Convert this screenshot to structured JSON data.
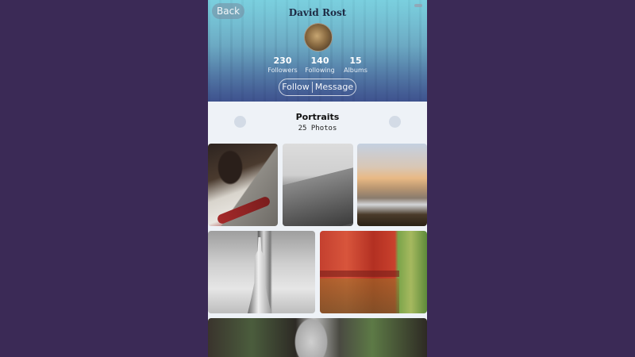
{
  "profile": {
    "back_label": "Back",
    "name": "David Rost",
    "stats": [
      {
        "value": "230",
        "label": "Followers"
      },
      {
        "value": "140",
        "label": "Following"
      },
      {
        "value": "15",
        "label": "Albums"
      }
    ],
    "follow_label": "Follow",
    "message_label": "Message"
  },
  "album": {
    "title": "Portraits",
    "count": "25 Photos"
  },
  "colors": {
    "page_background": "#3b2a56",
    "content_background": "#eef2f7"
  },
  "icons": [
    "menu-icon",
    "avatar-image",
    "prev-dot",
    "next-dot"
  ]
}
